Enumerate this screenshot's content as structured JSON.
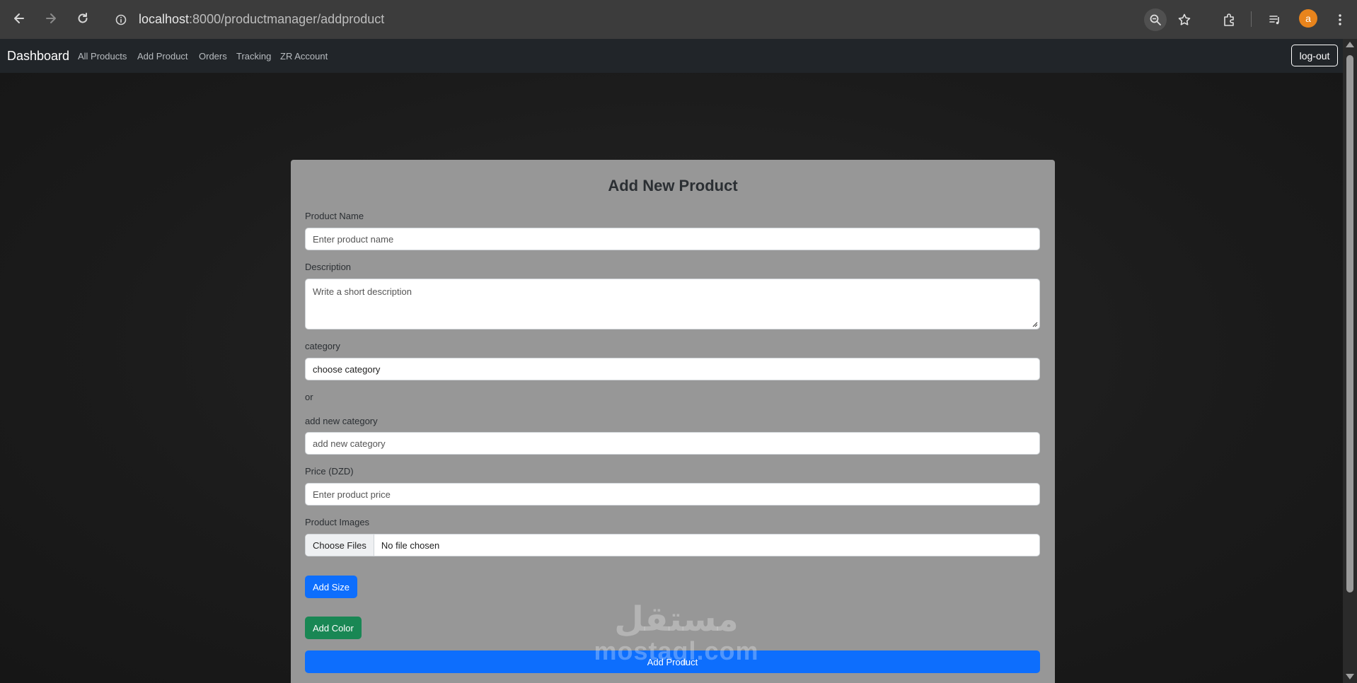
{
  "browser": {
    "url_host": "localhost",
    "url_path": ":8000/productmanager/addproduct",
    "avatar_letter": "a"
  },
  "navbar": {
    "brand": "Dashboard",
    "links": [
      "All Products",
      "Add Product",
      "Orders",
      "Tracking",
      "ZR Account"
    ],
    "logout_label": "log-out"
  },
  "form": {
    "title": "Add New Product",
    "product_name_label": "Product Name",
    "product_name_placeholder": "Enter product name",
    "description_label": "Description",
    "description_placeholder": "Write a short description",
    "category_label": "category",
    "category_selected": "choose category",
    "or_text": "or",
    "new_category_label": "add new category",
    "new_category_placeholder": "add new category",
    "price_label": "Price (DZD)",
    "price_placeholder": "Enter product price",
    "images_label": "Product Images",
    "file_button": "Choose Files",
    "file_status": "No file chosen",
    "add_size_label": "Add Size",
    "add_color_label": "Add Color",
    "submit_label": "Add Product"
  },
  "watermark": {
    "arabic": "مستقل",
    "latin": "mostaql.com"
  },
  "colors": {
    "primary": "#0d6efd",
    "success": "#198754",
    "navbar": "#212529",
    "card": "#979797"
  }
}
